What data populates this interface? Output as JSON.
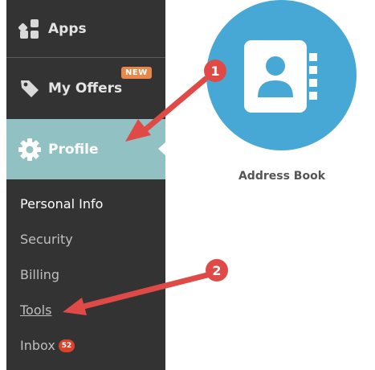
{
  "sidebar": {
    "apps_label": "Apps",
    "offers_label": "My Offers",
    "offers_badge": "NEW",
    "profile_label": "Profile",
    "sub_items": {
      "personal_info": "Personal Info",
      "security": "Security",
      "billing": "Billing",
      "tools": "Tools",
      "inbox": "Inbox",
      "inbox_count": "52"
    }
  },
  "app_tile": {
    "label": "Address Book"
  },
  "callouts": {
    "step1": "1",
    "step2": "2"
  },
  "colors": {
    "sidebar_bg": "#333333",
    "profile_highlight": "#92c1c4",
    "app_circle": "#47a8d6",
    "badge_new": "#e9874a",
    "badge_count": "#d9422d",
    "annotation": "#e04a46"
  },
  "icons": {
    "apps": "apps-grid-icon",
    "offers": "tag-icon",
    "profile": "gear-icon",
    "app_tile": "address-book-icon"
  }
}
